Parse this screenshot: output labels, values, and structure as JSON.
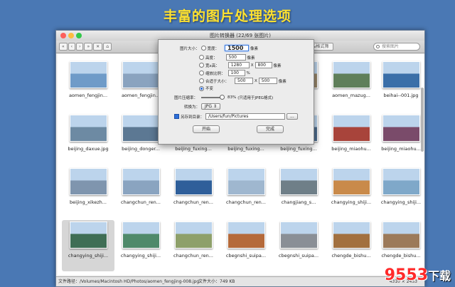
{
  "banner": {
    "title": "丰富的图片处理选项"
  },
  "window": {
    "title": "图片转换器 (22/69 张图片)",
    "toolbar": {
      "nav_buttons": [
        "«",
        "‹",
        "›",
        "»",
        "✕",
        "⌂"
      ],
      "filter_label": "根据大小&格式筛选",
      "search_placeholder": "搜索图片"
    },
    "statusbar": {
      "path": "文件路径：/Volumes/Macintosh HD/Photos/aomen_fengjing-008.jpg",
      "size": "文件大小：749 KB",
      "dimensions": "4310 × 2453"
    }
  },
  "grid": {
    "rows": [
      [
        {
          "label": "aomen_fengjin...",
          "color": "#6f9bc8"
        },
        {
          "label": "aomen_fengjin...",
          "color": "#8aa3bf"
        },
        {
          "label": "",
          "color": "#7a8fa6"
        },
        {
          "label": "",
          "color": "#4a6a8c"
        },
        {
          "label": "",
          "color": "#98876a"
        },
        {
          "label": "aomen_mazug...",
          "color": "#5f7f5a"
        },
        {
          "label": "beihai--001.jpg",
          "color": "#3b6fa8"
        }
      ],
      [
        {
          "label": "beijing_daxue.jpg",
          "color": "#6d8aa3"
        },
        {
          "label": "beijing_donger...",
          "color": "#5c7893"
        },
        {
          "label": "beijing_fuxing...",
          "color": "#34495f"
        },
        {
          "label": "beijing_fuxing...",
          "color": "#2e4057"
        },
        {
          "label": "beijing_fuxing...",
          "color": "#4f6e8f"
        },
        {
          "label": "beijing_miaohu...",
          "color": "#a8443b"
        },
        {
          "label": "beijing_miaohu...",
          "color": "#7a4b6a"
        }
      ],
      [
        {
          "label": "beijing_xikezh...",
          "color": "#7f95ae"
        },
        {
          "label": "changchun_ren...",
          "color": "#8aa4c0"
        },
        {
          "label": "changchun_ren...",
          "color": "#2f5f9a"
        },
        {
          "label": "changchun_ren...",
          "color": "#9fb7cf"
        },
        {
          "label": "changjiang_s...",
          "color": "#6f7f88"
        },
        {
          "label": "changying_shiji...",
          "color": "#c98a4a"
        },
        {
          "label": "changying_shiji...",
          "color": "#7fa8c9"
        }
      ],
      [
        {
          "label": "changying_shiji...",
          "color": "#3f6e55"
        },
        {
          "label": "changying_shiji...",
          "color": "#4f8a6a"
        },
        {
          "label": "changchun_ren...",
          "color": "#8ea06a"
        },
        {
          "label": "cbegnshi_suipa...",
          "color": "#b56a3a"
        },
        {
          "label": "cbegnshi_suipa...",
          "color": "#8a8f96"
        },
        {
          "label": "chengde_bishu...",
          "color": "#a2703f"
        },
        {
          "label": "chengde_bishu...",
          "color": "#9c7a5a"
        }
      ]
    ]
  },
  "dialog": {
    "size_label": "图片大小：",
    "width_label": "宽度：",
    "width_value": "1500",
    "height_label": "高度：",
    "height_value": "500",
    "wh_label": "宽x高：",
    "wh_w": "1280",
    "wh_h": "800",
    "scale_label": "缩放比例：",
    "scale_value": "100",
    "percent": "%",
    "fit_label": "合适于大小：",
    "fit_w": "500",
    "fit_h": "500",
    "px": "像素",
    "x": "X",
    "none_label": "不变",
    "compress_label": "图片压缩率：",
    "compress_value": "83%",
    "compress_note": "(只适用于JPEG格式)",
    "convert_label": "转换为：",
    "format": "JPG",
    "saveto_label": "另存到目录：",
    "saveto_path": "/Users/fun/Pictures",
    "browse": "...",
    "start": "开始",
    "done": "完成"
  },
  "watermark": {
    "main": "9553",
    "sub": "下载"
  }
}
